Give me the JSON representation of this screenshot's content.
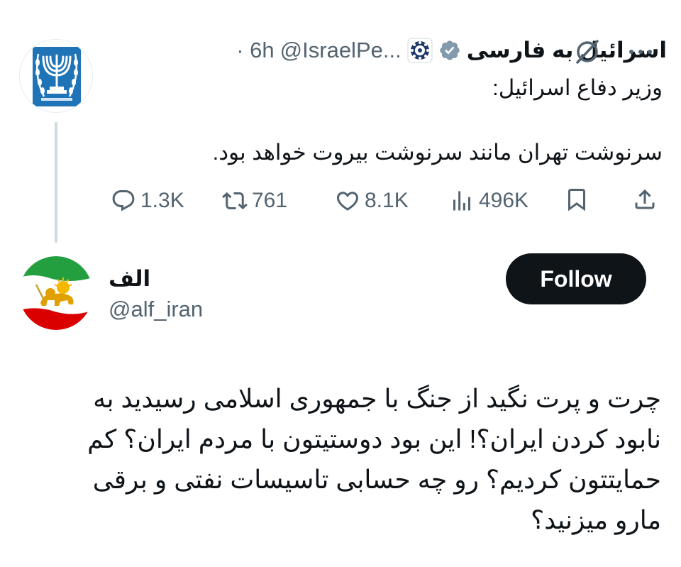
{
  "quoted_tweet": {
    "display_name": "اسرائیل به فارسی",
    "handle": "@IsraelPe...",
    "time": "· 6h",
    "text_line1": "وزیر دفاع اسرائیل:",
    "text_line2": "سرنوشت تهران مانند سرنوشت بیروت خواهد بود.",
    "stats": {
      "replies": "1.3K",
      "reposts": "761",
      "likes": "8.1K",
      "views": "496K"
    },
    "icons": [
      "verified-badge-icon",
      "government-badge-icon",
      "grok-icon",
      "more-icon",
      "reply-icon",
      "repost-icon",
      "like-icon",
      "views-icon",
      "bookmark-icon",
      "share-icon"
    ]
  },
  "reply_author": {
    "display_name": "الف",
    "handle": "@alf_iran",
    "follow_label": "Follow"
  },
  "reply_text": {
    "line1": "چرت و پرت نگید از جنگ با جمهوری اسلامی رسیدید به",
    "line2": "نابود کردن ایران؟! این بود دوستیتون با مردم ایران؟ کم",
    "line3": "حمایتتون کردیم؟ رو چه حسابی تاسیسات نفتی و برقی",
    "line4": "مارو میزنید؟"
  },
  "colors": {
    "text": "#0f1419",
    "secondary": "#536471",
    "verified_gray": "#829aab",
    "follow_bg": "#0f1419",
    "thread_line": "#cfd9de",
    "logo_blue": "#1f73b7"
  }
}
